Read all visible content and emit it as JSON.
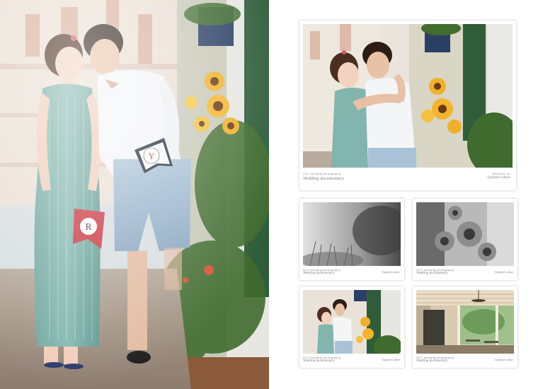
{
  "album": {
    "cards": [
      {
        "id": "card-large",
        "year_caption": "2017 wedding photography",
        "title_caption": "Wedding  documentary",
        "right_top": "Memories for",
        "right_caption": "Updated culture"
      },
      {
        "id": "card-bw-left",
        "year_caption": "2017 wedding photography",
        "title_caption": "Wedding  documentary",
        "right_caption": "Updated culture"
      },
      {
        "id": "card-bw-right",
        "year_caption": "2017 wedding photography",
        "title_caption": "Wedding  documentary",
        "right_caption": "Updated culture"
      },
      {
        "id": "card-couple-small",
        "year_caption": "2017 wedding photography",
        "title_caption": "Wedding  documentary",
        "right_caption": "Updated culture"
      },
      {
        "id": "card-cafe",
        "year_caption": "2017 wedding photography",
        "title_caption": "Wedding  documentary",
        "right_caption": "Updated culture"
      }
    ],
    "pennant_letters": [
      "Y",
      "R"
    ]
  }
}
